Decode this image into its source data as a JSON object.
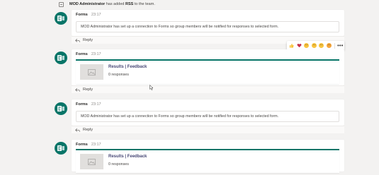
{
  "system_message": {
    "actor": "MOD Administrator",
    "text_before": " has added ",
    "target": "RSS",
    "text_after": " to the team."
  },
  "posts": [
    {
      "author": "Forms",
      "time": "23:17",
      "kind": "text",
      "body": "MOD Administrator has set up a connection to Forms so group members will be notified for responses to selected form.",
      "reply_label": "Reply"
    },
    {
      "author": "Forms",
      "time": "23:17",
      "kind": "form",
      "card_title": "Results | Feedback",
      "card_subtitle": "0 responses",
      "reply_label": "Reply"
    },
    {
      "author": "Forms",
      "time": "23:17",
      "kind": "text",
      "body": "MOD Administrator has set up a connection to Forms so group members will be notified for responses to selected form.",
      "reply_label": "Reply"
    },
    {
      "author": "Forms",
      "time": "23:17",
      "kind": "form",
      "card_title": "Results | Feedback",
      "card_subtitle": "0 responses"
    }
  ],
  "reactions": [
    "like-icon",
    "heart-icon",
    "laugh-icon",
    "surprised-icon",
    "sad-icon",
    "angry-icon"
  ],
  "colors": {
    "background": "#f3f2f1",
    "card": "#ffffff",
    "forms_teal": "#077568",
    "link_purple": "#464775",
    "heart_red": "#c4314b",
    "like_yellow": "#f8c33e"
  }
}
